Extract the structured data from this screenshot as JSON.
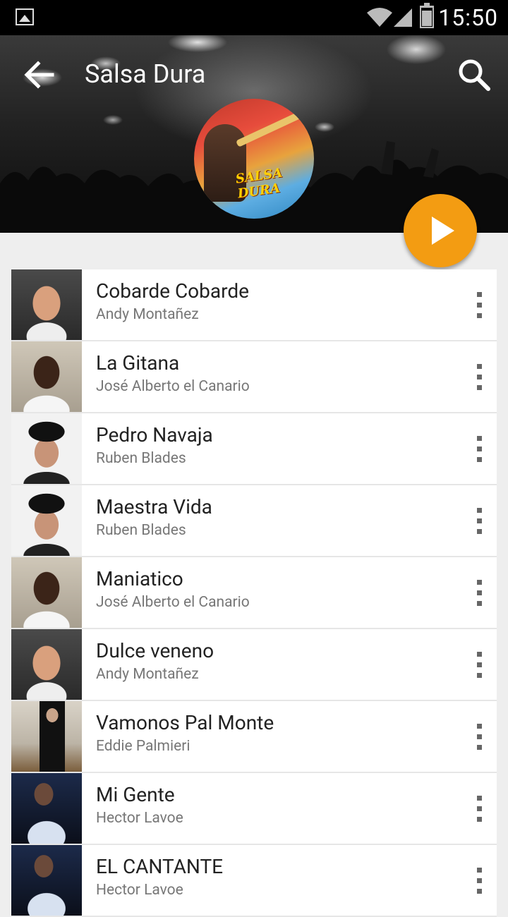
{
  "status_bar": {
    "time": "15:50"
  },
  "header": {
    "title": "Salsa Dura",
    "album_art_text": "SALSA DURA"
  },
  "songs": [
    {
      "title": "Cobarde Cobarde",
      "artist": "Andy Montañez",
      "thumb": "andy"
    },
    {
      "title": "La Gitana",
      "artist": "José Alberto el Canario",
      "thumb": "jose"
    },
    {
      "title": "Pedro Navaja",
      "artist": "Ruben Blades",
      "thumb": "ruben"
    },
    {
      "title": "Maestra Vida",
      "artist": "Ruben Blades",
      "thumb": "ruben"
    },
    {
      "title": "Maniatico",
      "artist": "José Alberto el Canario",
      "thumb": "jose"
    },
    {
      "title": "Dulce veneno",
      "artist": "Andy Montañez",
      "thumb": "andy"
    },
    {
      "title": "Vamonos Pal Monte",
      "artist": "Eddie Palmieri",
      "thumb": "eddie"
    },
    {
      "title": "Mi Gente",
      "artist": "Hector Lavoe",
      "thumb": "hector"
    },
    {
      "title": "EL CANTANTE",
      "artist": "Hector Lavoe",
      "thumb": "hector"
    }
  ],
  "colors": {
    "accent": "#f39c12",
    "background": "#eeeeee",
    "title_text": "#222222",
    "artist_text": "#777777"
  },
  "icons": {
    "status": [
      "gallery-icon",
      "wifi-icon",
      "signal-icon",
      "battery-icon"
    ],
    "header": [
      "back-arrow-icon",
      "search-icon"
    ],
    "fab": "play-icon",
    "row": "more-vert-icon"
  }
}
